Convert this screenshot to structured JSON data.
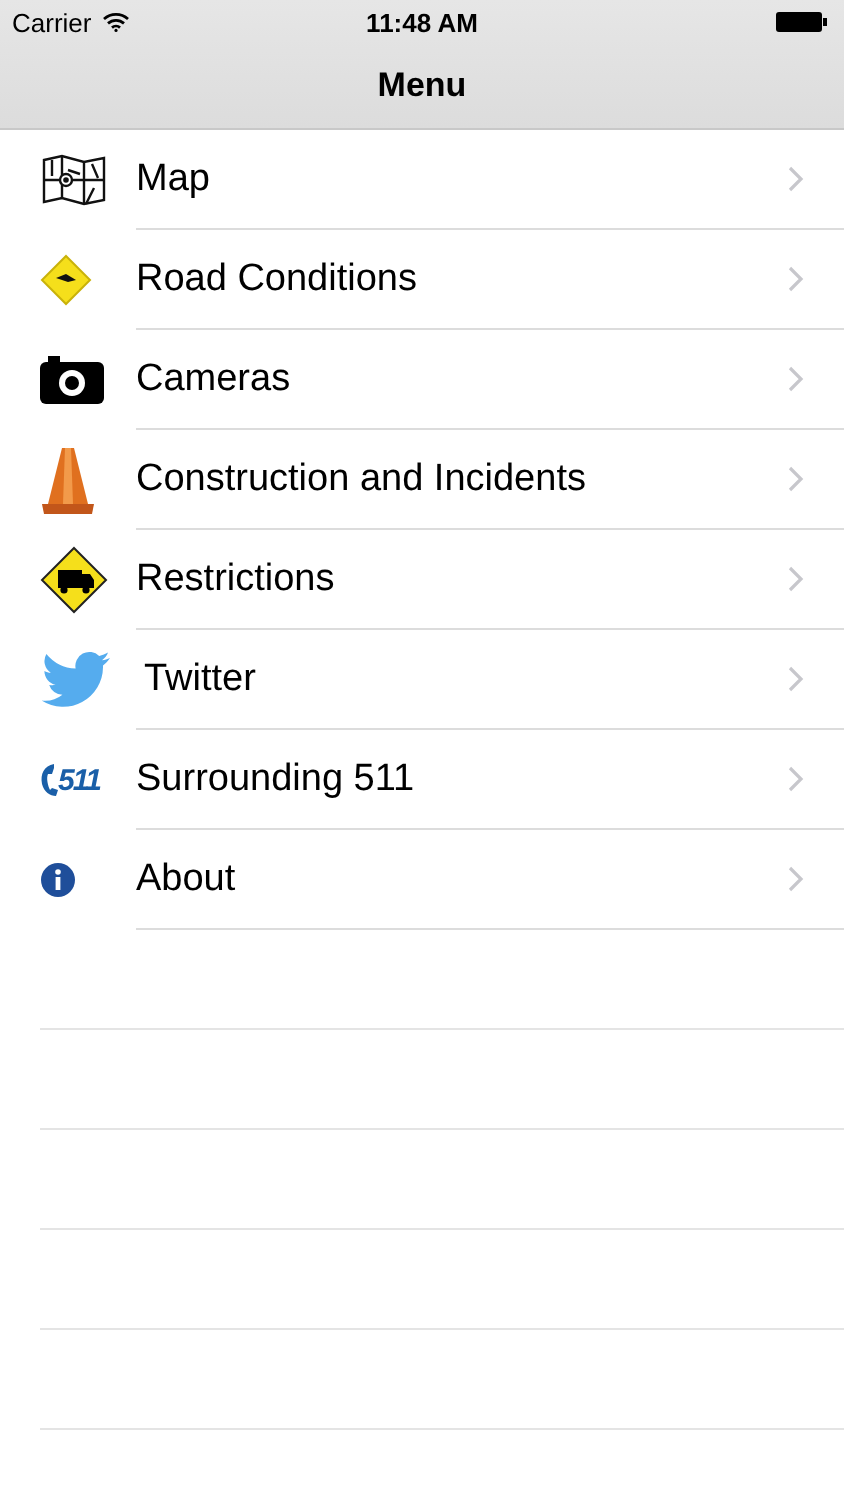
{
  "status_bar": {
    "carrier": "Carrier",
    "time": "11:48 AM"
  },
  "nav": {
    "title": "Menu"
  },
  "items": [
    {
      "kind": "map",
      "label": "Map"
    },
    {
      "kind": "diamond-sign",
      "label": "Road Conditions"
    },
    {
      "kind": "camera",
      "label": "Cameras"
    },
    {
      "kind": "cone",
      "label": "Construction and Incidents"
    },
    {
      "kind": "truck-sign",
      "label": "Restrictions"
    },
    {
      "kind": "bird",
      "label": "Twitter"
    },
    {
      "kind": "logo",
      "label": "Surrounding 511",
      "logo_text": "511"
    },
    {
      "kind": "info",
      "label": "About"
    }
  ]
}
